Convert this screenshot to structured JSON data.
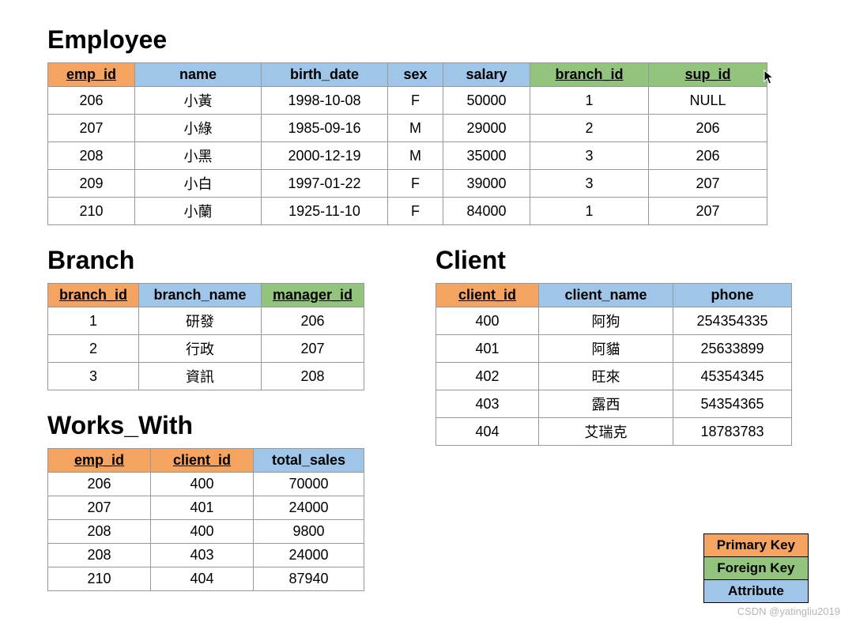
{
  "employee": {
    "title": "Employee",
    "headers": [
      {
        "label": "emp_id",
        "kind": "pk"
      },
      {
        "label": "name",
        "kind": "attr"
      },
      {
        "label": "birth_date",
        "kind": "attr"
      },
      {
        "label": "sex",
        "kind": "attr"
      },
      {
        "label": "salary",
        "kind": "attr"
      },
      {
        "label": "branch_id",
        "kind": "fk"
      },
      {
        "label": "sup_id",
        "kind": "fk"
      }
    ],
    "rows": [
      [
        "206",
        "小黃",
        "1998-10-08",
        "F",
        "50000",
        "1",
        "NULL"
      ],
      [
        "207",
        "小綠",
        "1985-09-16",
        "M",
        "29000",
        "2",
        "206"
      ],
      [
        "208",
        "小黑",
        "2000-12-19",
        "M",
        "35000",
        "3",
        "206"
      ],
      [
        "209",
        "小白",
        "1997-01-22",
        "F",
        "39000",
        "3",
        "207"
      ],
      [
        "210",
        "小蘭",
        "1925-11-10",
        "F",
        "84000",
        "1",
        "207"
      ]
    ]
  },
  "branch": {
    "title": "Branch",
    "headers": [
      {
        "label": "branch_id",
        "kind": "pk"
      },
      {
        "label": "branch_name",
        "kind": "attr"
      },
      {
        "label": "manager_id",
        "kind": "fk"
      }
    ],
    "rows": [
      [
        "1",
        "研發",
        "206"
      ],
      [
        "2",
        "行政",
        "207"
      ],
      [
        "3",
        "資訊",
        "208"
      ]
    ]
  },
  "works_with": {
    "title": "Works_With",
    "headers": [
      {
        "label": "emp_id",
        "kind": "pk"
      },
      {
        "label": "client_id",
        "kind": "pk"
      },
      {
        "label": "total_sales",
        "kind": "attr"
      }
    ],
    "rows": [
      [
        "206",
        "400",
        "70000"
      ],
      [
        "207",
        "401",
        "24000"
      ],
      [
        "208",
        "400",
        "9800"
      ],
      [
        "208",
        "403",
        "24000"
      ],
      [
        "210",
        "404",
        "87940"
      ]
    ]
  },
  "client": {
    "title": "Client",
    "headers": [
      {
        "label": "client_id",
        "kind": "pk"
      },
      {
        "label": "client_name",
        "kind": "attr"
      },
      {
        "label": "phone",
        "kind": "attr"
      }
    ],
    "rows": [
      [
        "400",
        "阿狗",
        "254354335"
      ],
      [
        "401",
        "阿貓",
        "25633899"
      ],
      [
        "402",
        "旺來",
        "45354345"
      ],
      [
        "403",
        "露西",
        "54354365"
      ],
      [
        "404",
        "艾瑞克",
        "18783783"
      ]
    ]
  },
  "legend": {
    "pk": "Primary Key",
    "fk": "Foreign Key",
    "attr": "Attribute"
  },
  "colors": {
    "pk": "#f4a460",
    "fk": "#93c47d",
    "attr": "#9fc5e8"
  },
  "watermark": "CSDN @yatingliu2019"
}
